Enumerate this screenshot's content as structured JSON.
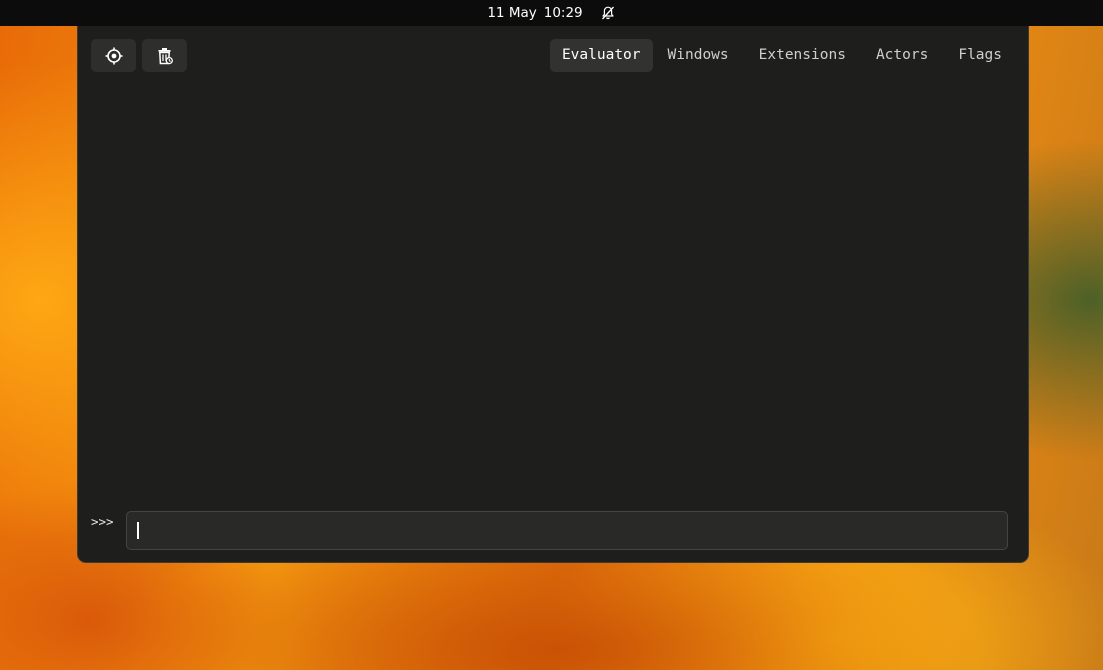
{
  "topbar": {
    "date": "11 May",
    "time": "10:29",
    "notification_icon": "bell-muted-icon"
  },
  "looking_glass": {
    "toolbar": {
      "picker_icon": "target-picker-icon",
      "clear_icon": "trash-clear-icon"
    },
    "tabs": [
      {
        "label": "Evaluator",
        "active": true
      },
      {
        "label": "Windows",
        "active": false
      },
      {
        "label": "Extensions",
        "active": false
      },
      {
        "label": "Actors",
        "active": false
      },
      {
        "label": "Flags",
        "active": false
      }
    ],
    "prompt": ">>>",
    "entry_value": ""
  },
  "colors": {
    "panel_bg": "#1e1e1c",
    "topbar_bg": "#0c0c0c",
    "active_tab_bg": "#323230"
  }
}
